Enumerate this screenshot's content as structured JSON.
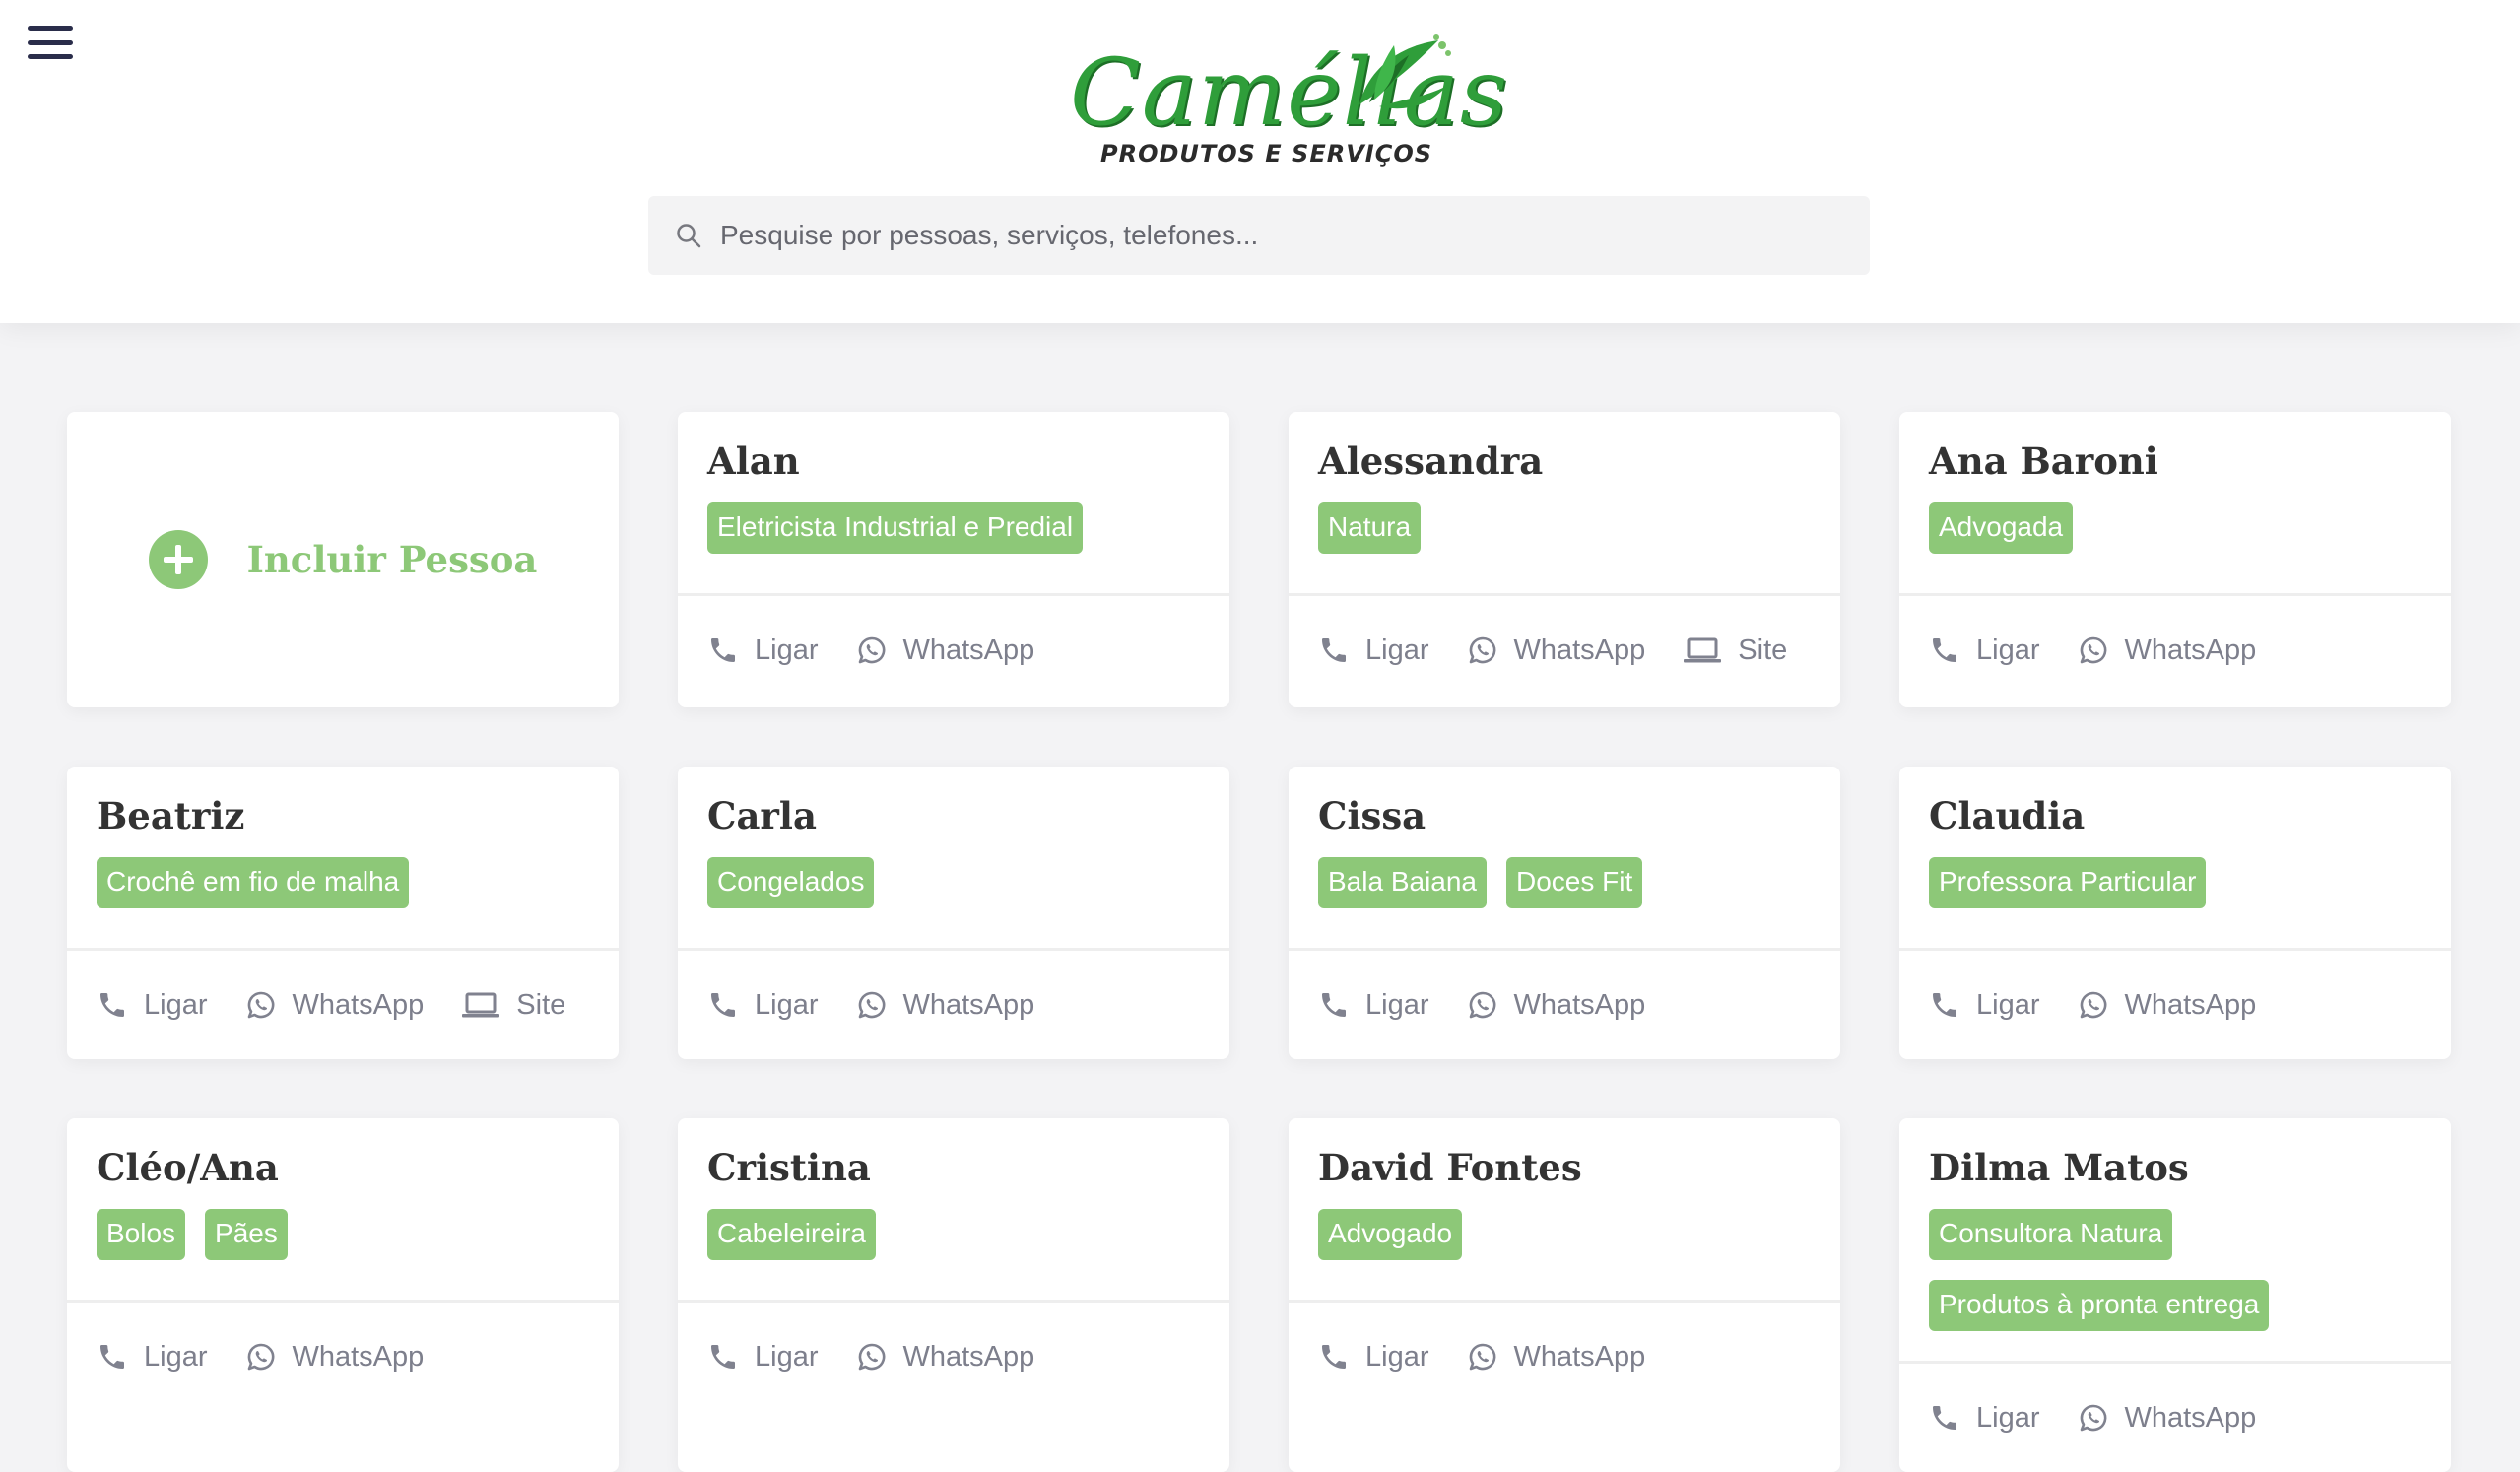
{
  "header": {
    "logo_script": "Camélias",
    "logo_subtitle": "PRODUTOS E SERVIÇOS",
    "search_placeholder": "Pesquise por pessoas, serviços, telefones..."
  },
  "add_card": {
    "label": "Incluir Pessoa"
  },
  "actions": {
    "call": "Ligar",
    "whatsapp": "WhatsApp",
    "site": "Site"
  },
  "colors": {
    "accent": "#8dc878",
    "muted": "#7d7f8c",
    "title": "#333333"
  },
  "people": [
    {
      "name": "Alan",
      "tags": [
        "Eletricista Industrial e Predial"
      ],
      "site": false
    },
    {
      "name": "Alessandra",
      "tags": [
        "Natura"
      ],
      "site": true
    },
    {
      "name": "Ana Baroni",
      "tags": [
        "Advogada"
      ],
      "site": false
    },
    {
      "name": "Beatriz",
      "tags": [
        "Crochê em fio de malha"
      ],
      "site": true
    },
    {
      "name": "Carla",
      "tags": [
        "Congelados"
      ],
      "site": false
    },
    {
      "name": "Cissa",
      "tags": [
        "Bala Baiana",
        "Doces Fit"
      ],
      "site": false
    },
    {
      "name": "Claudia",
      "tags": [
        "Professora Particular"
      ],
      "site": false
    },
    {
      "name": "Cléo/Ana",
      "tags": [
        "Bolos",
        "Pães"
      ],
      "site": false
    },
    {
      "name": "Cristina",
      "tags": [
        "Cabeleireira"
      ],
      "site": false
    },
    {
      "name": "David Fontes",
      "tags": [
        "Advogado"
      ],
      "site": false
    },
    {
      "name": "Dilma Matos",
      "tags": [
        "Consultora Natura",
        "Produtos à pronta entrega"
      ],
      "site": false
    }
  ]
}
